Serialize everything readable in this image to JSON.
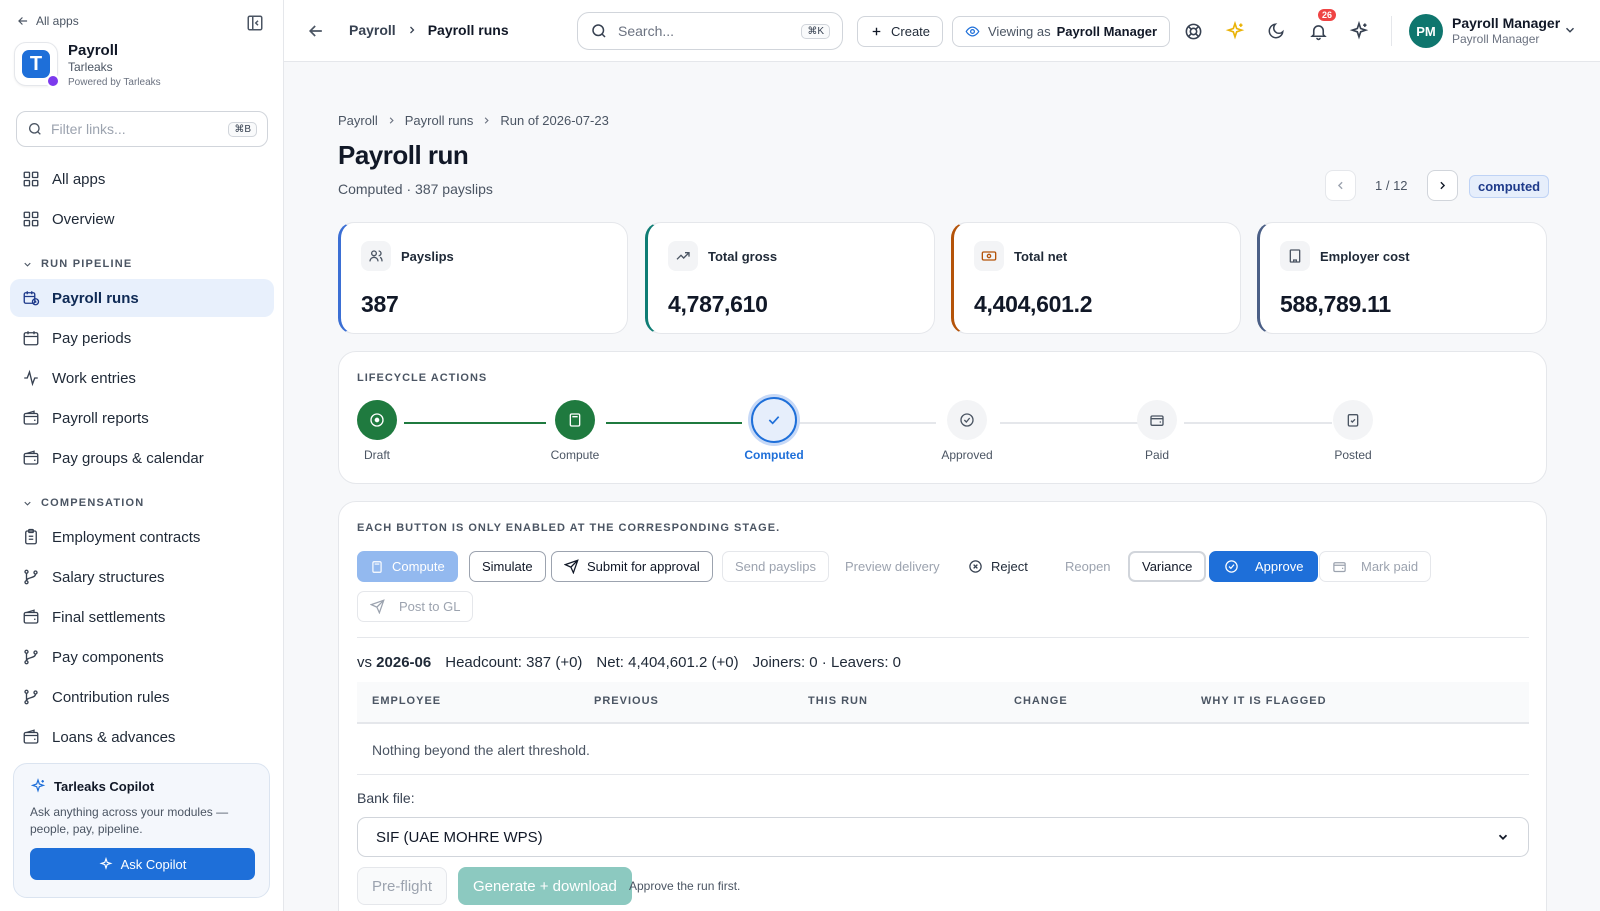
{
  "sidebar": {
    "back_label": "All apps",
    "app_name": "Payroll",
    "app_org": "Tarleaks",
    "app_powered": "Powered by Tarleaks",
    "filter_placeholder": "Filter links...",
    "filter_kbd": "⌘B",
    "top_items": [
      {
        "label": "All apps",
        "icon": "grid-icon"
      },
      {
        "label": "Overview",
        "icon": "grid-icon"
      }
    ],
    "sections": [
      {
        "label": "RUN PIPELINE",
        "items": [
          {
            "label": "Payroll runs",
            "icon": "calendar-clock-icon",
            "active": true
          },
          {
            "label": "Pay periods",
            "icon": "calendar-icon"
          },
          {
            "label": "Work entries",
            "icon": "activity-icon"
          },
          {
            "label": "Payroll reports",
            "icon": "wallet-icon"
          },
          {
            "label": "Pay groups & calendar",
            "icon": "wallet-icon"
          }
        ]
      },
      {
        "label": "COMPENSATION",
        "items": [
          {
            "label": "Employment contracts",
            "icon": "clipboard-icon"
          },
          {
            "label": "Salary structures",
            "icon": "branch-icon"
          },
          {
            "label": "Final settlements",
            "icon": "wallet-icon"
          },
          {
            "label": "Pay components",
            "icon": "branch-icon"
          },
          {
            "label": "Contribution rules",
            "icon": "branch-icon"
          },
          {
            "label": "Loans & advances",
            "icon": "wallet-icon"
          }
        ]
      }
    ],
    "copilot": {
      "title": "Tarleaks Copilot",
      "desc": "Ask anything across your modules — people, pay, pipeline.",
      "button": "Ask Copilot"
    }
  },
  "topbar": {
    "crumb_1": "Payroll",
    "crumb_2": "Payroll runs",
    "search_placeholder": "Search...",
    "search_kbd": "⌘K",
    "create_label": "Create",
    "viewing_prefix": "Viewing as",
    "viewing_role": "Payroll Manager",
    "notifications_count": "26",
    "user_initials": "PM",
    "user_name": "Payroll Manager",
    "user_role": "Payroll Manager"
  },
  "page": {
    "crumbs": [
      "Payroll",
      "Payroll runs",
      "Run of 2026-07-23"
    ],
    "title": "Payroll run",
    "subtitle": "Computed · 387 payslips",
    "pager": "1 / 12",
    "status": "computed"
  },
  "kpis": [
    {
      "label": "Payslips",
      "value": "387",
      "icon": "users-icon",
      "accent": "#3b6fd4"
    },
    {
      "label": "Total gross",
      "value": "4,787,610",
      "icon": "trending-up-icon",
      "accent": "#0f7d74"
    },
    {
      "label": "Total net",
      "value": "4,404,601.2",
      "icon": "banknote-icon",
      "accent": "#b45309"
    },
    {
      "label": "Employer cost",
      "value": "588,789.11",
      "icon": "building-icon",
      "accent": "#4b5f86"
    }
  ],
  "lifecycle": {
    "label": "LIFECYCLE ACTIONS",
    "steps": [
      {
        "label": "Draft",
        "state": "done"
      },
      {
        "label": "Compute",
        "state": "done"
      },
      {
        "label": "Computed",
        "state": "current"
      },
      {
        "label": "Approved",
        "state": "todo"
      },
      {
        "label": "Paid",
        "state": "todo"
      },
      {
        "label": "Posted",
        "state": "todo"
      }
    ]
  },
  "actions": {
    "label": "EACH BUTTON IS ONLY ENABLED AT THE CORRESPONDING STAGE.",
    "buttons": {
      "compute": "Compute",
      "simulate": "Simulate",
      "submit": "Submit for approval",
      "send": "Send payslips",
      "preview": "Preview delivery",
      "reject": "Reject",
      "reopen": "Reopen",
      "variance": "Variance",
      "approve": "Approve",
      "mark_paid": "Mark paid",
      "post_gl": "Post to GL"
    }
  },
  "variance": {
    "vs_prefix": "vs",
    "vs_period": "2026-06",
    "headcount": "Headcount: 387 (+0)",
    "net": "Net: 4,404,601.2 (+0)",
    "movers": "Joiners: 0 · Leavers: 0",
    "columns": [
      "EMPLOYEE",
      "PREVIOUS",
      "THIS RUN",
      "CHANGE",
      "WHY IT IS FLAGGED"
    ],
    "empty": "Nothing beyond the alert threshold."
  },
  "bank": {
    "label": "Bank file:",
    "selected": "SIF (UAE MOHRE WPS)",
    "preflight": "Pre-flight",
    "generate": "Generate + download",
    "hint": "Approve the run first."
  }
}
